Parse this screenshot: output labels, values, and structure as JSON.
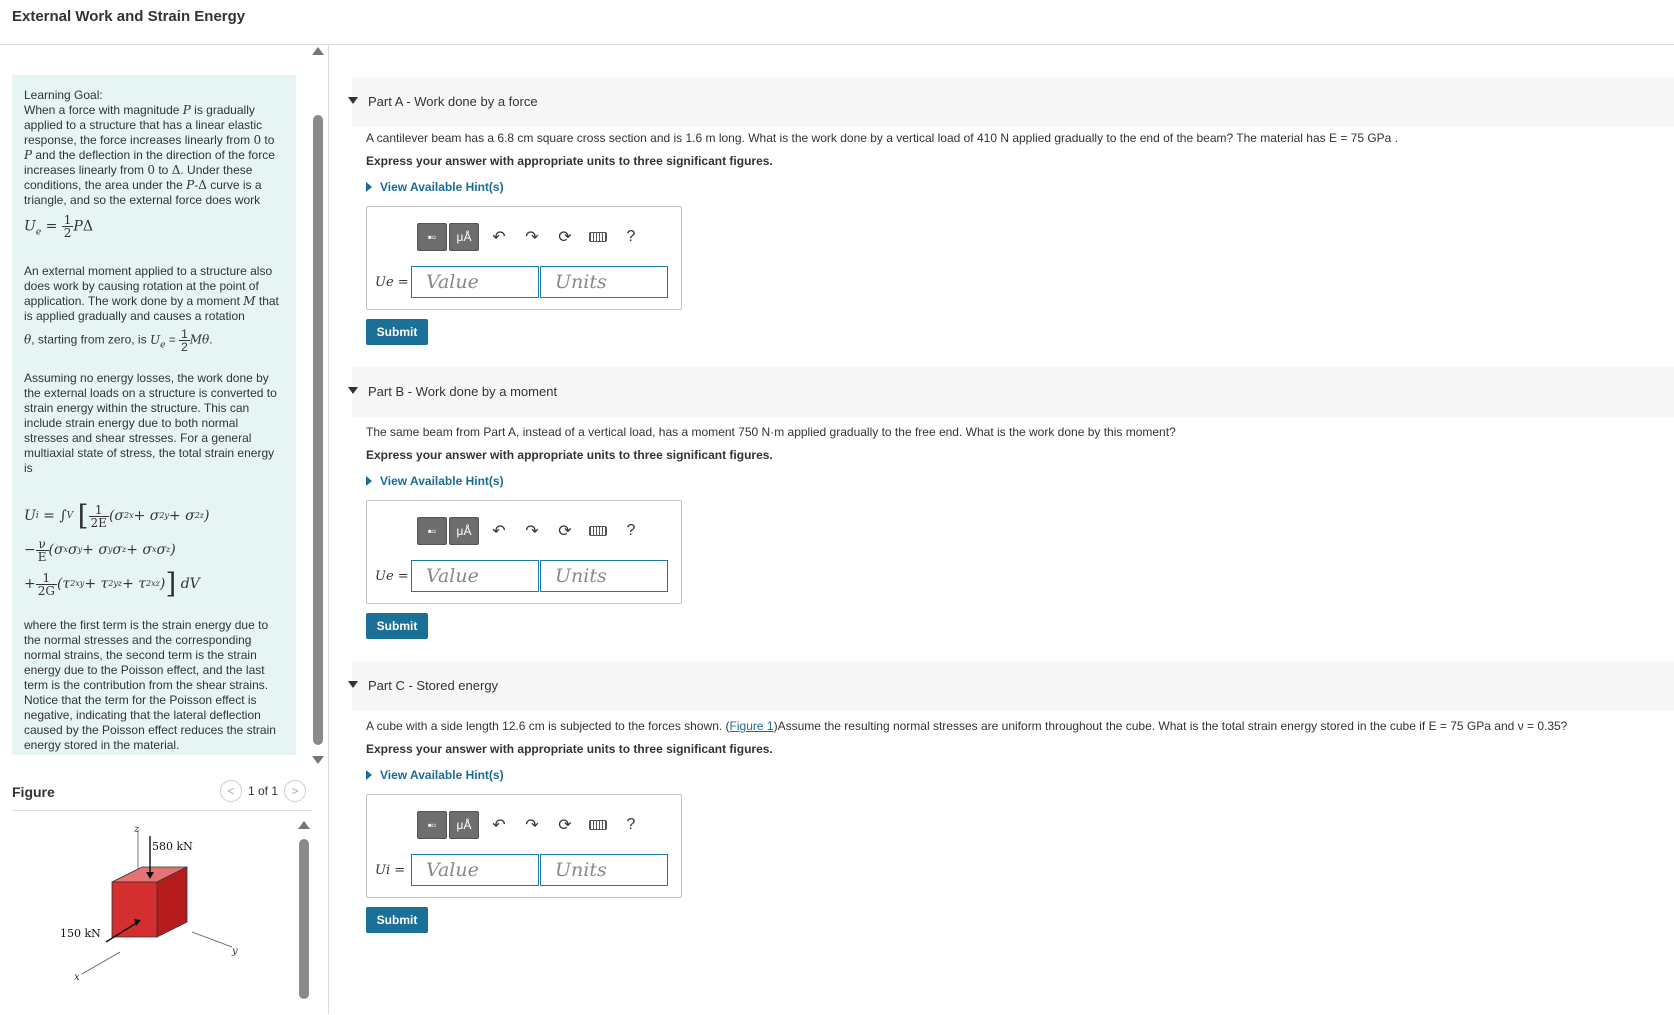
{
  "header": {
    "title": "External Work and Strain Energy"
  },
  "learning_goal": {
    "heading": "Learning Goal:",
    "p1": "When a force with magnitude P is gradually applied to a structure that has a linear elastic response, the force increases linearly from 0 to P and the deflection in the direction of the force increases linearly from 0 to Δ. Under these conditions, the area under the P-Δ curve is a triangle, and so the external force does work",
    "eq1": "Ue = ½ PΔ",
    "p2": "An external moment applied to a structure also does work by causing rotation at the point of application. The work done by a moment M that is applied gradually and causes a rotation",
    "p2_end": "θ, starting from zero, is Ue = ½ Mθ.",
    "p3": "Assuming no energy losses, the work done by the external loads on a structure is converted to strain energy within the structure. This can include strain energy due to both normal stresses and shear stresses. For a general multiaxial state of stress, the total strain energy is",
    "p4": "where the first term is the strain energy due to the normal stresses and the corresponding normal strains, the second term is the strain energy due to the Poisson effect, and the last term is the contribution from the shear strains. Notice that the term for the Poisson effect is negative, indicating that the lateral deflection caused by the Poisson effect reduces the strain energy stored in the material."
  },
  "figure": {
    "label": "Figure",
    "pager": "1 of 1",
    "axis_z": "z",
    "axis_x": "x",
    "axis_y": "y",
    "load_top": "580 kN",
    "load_side": "150 kN",
    "cube_color": "#d32f2f"
  },
  "parts": [
    {
      "label": "Part A",
      "title": " - Work done by a force",
      "question": "A cantilever beam has a 6.8 cm square cross section and is 1.6 m long. What is the work done by a vertical load of 410 N applied gradually to the end of the beam? The material has E = 75 GPa .",
      "express": "Express your answer with appropriate units to three significant figures.",
      "hint": "View Available Hint(s)",
      "answer_label": "Ue =",
      "value_placeholder": "Value",
      "units_placeholder": "Units",
      "submit": "Submit"
    },
    {
      "label": "Part B",
      "title": " - Work done by a moment",
      "question": "The same beam from Part A, instead of a vertical load, has a moment 750 N·m applied gradually to the free end. What is the work done by this moment?",
      "express": "Express your answer with appropriate units to three significant figures.",
      "hint": "View Available Hint(s)",
      "answer_label": "Ue =",
      "value_placeholder": "Value",
      "units_placeholder": "Units",
      "submit": "Submit"
    },
    {
      "label": "Part C",
      "title": " - Stored energy",
      "question_pre": "A cube with a side length 12.6 cm is subjected to the forces shown. (",
      "question_link": "Figure 1",
      "question_post": ")Assume the resulting normal stresses are uniform throughout the cube. What is the total strain energy stored in the cube if E = 75 GPa and ν = 0.35?",
      "express": "Express your answer with appropriate units to three significant figures.",
      "hint": "View Available Hint(s)",
      "answer_label": "Ui =",
      "value_placeholder": "Value",
      "units_placeholder": "Units",
      "submit": "Submit"
    }
  ],
  "toolbar": {
    "micro_label": "μÅ",
    "help": "?"
  },
  "colors": {
    "accent": "#1a7096",
    "goal_bg": "#e6f4f4"
  }
}
